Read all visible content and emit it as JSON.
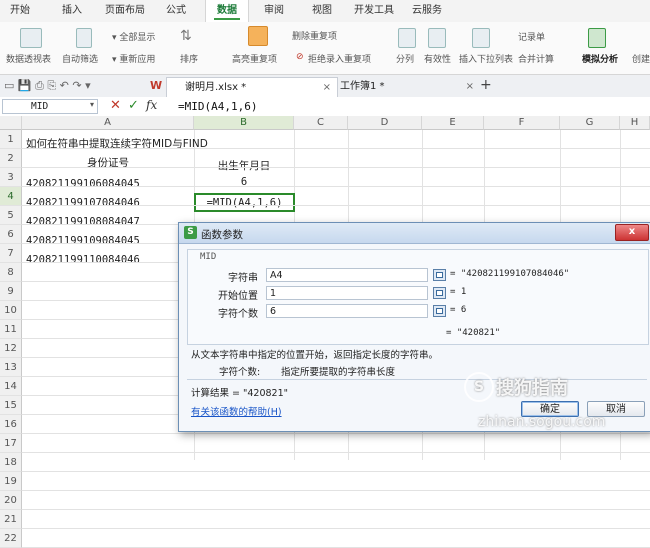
{
  "ribbon_tabs": [
    "开始",
    "插入",
    "页面布局",
    "公式",
    "数据",
    "审阅",
    "视图",
    "开发工具",
    "云服务"
  ],
  "active_tab": "数据",
  "ribbon": {
    "pivot": "数据透视表",
    "autofilter": "自动筛选",
    "show_all": "全部显示",
    "reapply": "重新应用",
    "sort": "排序",
    "highlight_dup": "高亮重复项",
    "delete_dup": "删除重复项",
    "reject_dup": "拒绝录入重复项",
    "split": "分列",
    "validity": "有效性",
    "insert_dropdown": "插入下拉列表",
    "merge_calc": "合并计算",
    "records": "记录单",
    "simulate": "模拟分析",
    "create": "创建"
  },
  "doc_tabs": {
    "file1": "谢明月.xlsx *",
    "file2": "工作簿1 *",
    "new_tab": "+"
  },
  "formula_bar": {
    "name_box": "MID",
    "fx": "fx",
    "formula": "=MID(A4,1,6)"
  },
  "columns": [
    "A",
    "B",
    "C",
    "D",
    "E",
    "F",
    "G",
    "H"
  ],
  "rows": [
    "1",
    "2",
    "3",
    "4",
    "5",
    "6",
    "7",
    "8",
    "9",
    "10",
    "11",
    "12",
    "13",
    "14",
    "15",
    "16",
    "17",
    "18",
    "19",
    "20",
    "21",
    "22"
  ],
  "cells": {
    "a1": "如何在符串中提取连续字符MID与FIND",
    "a2": "身份证号",
    "b2": "出生年月日",
    "a3": "420821199106084045",
    "b3": "6",
    "a4": "420821199107084046",
    "b4": "=MID(A4,1,6)",
    "a5": "420821199108084047",
    "a6": "420821199109084045",
    "a7": "420821199110084046"
  },
  "dialog": {
    "title": "函数参数",
    "function_name": "MID",
    "arg1_label": "字符串",
    "arg1_value": "A4",
    "arg1_result": "= \"420821199107084046\"",
    "arg2_label": "开始位置",
    "arg2_value": "1",
    "arg2_result": "= 1",
    "arg3_label": "字符个数",
    "arg3_value": "6",
    "arg3_result": "= 6",
    "formula_result": "= \"420821\"",
    "description": "从文本字符串中指定的位置开始，返回指定长度的字符串。",
    "param_desc_label": "字符个数:",
    "param_desc": "指定所要提取的字符串长度",
    "calc_result": "计算结果 = \"420821\"",
    "help_link": "有关该函数的帮助(H)",
    "ok": "确定",
    "cancel": "取消",
    "close": "x"
  },
  "watermark": {
    "brand": "搜狗指南",
    "url": "zhinan.sogou.com"
  },
  "colors": {
    "accent": "#3c9b46",
    "link": "#1a56c8",
    "selection": "#2a8a2a"
  }
}
